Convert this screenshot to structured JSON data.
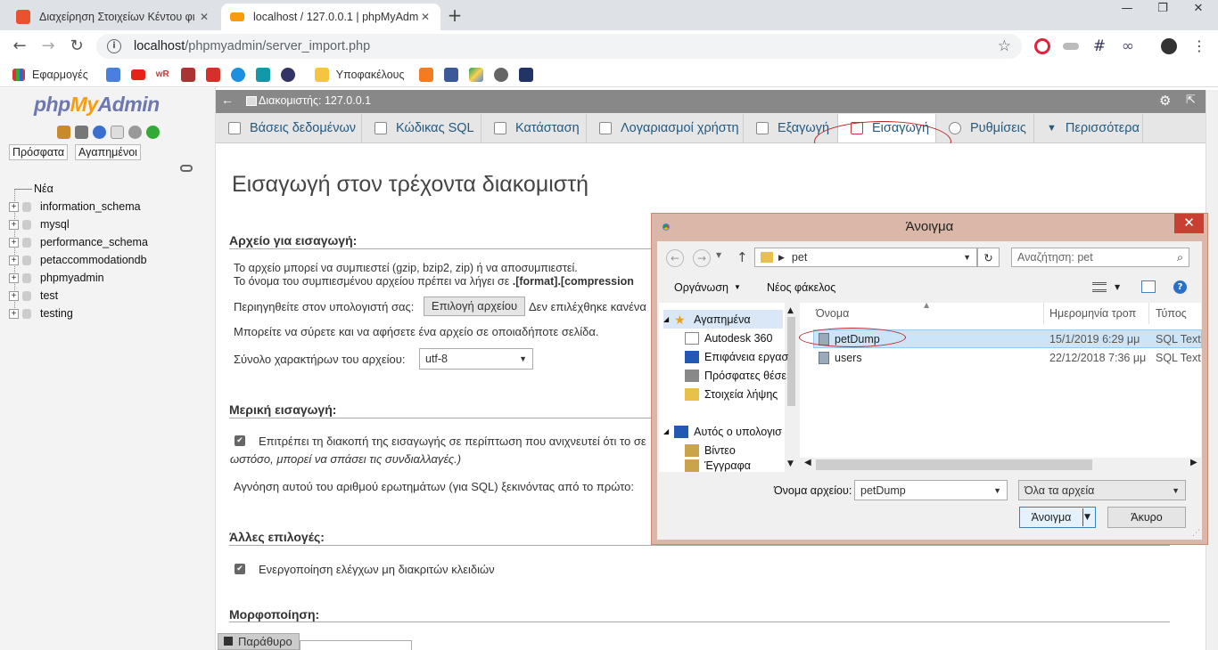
{
  "browser": {
    "tabs": [
      {
        "title": "Διαχείρηση Στοιχείων Κέντου φι"
      },
      {
        "title": "localhost / 127.0.0.1 | phpMyAdm"
      }
    ],
    "url_host": "localhost",
    "url_path": "/phpmyadmin/server_import.php",
    "bookmarks": {
      "apps": "Εφαρμογές",
      "folder": "Υποφακέλους"
    }
  },
  "sidebar": {
    "logo_php": "php",
    "logo_my": "My",
    "logo_admin": "Admin",
    "recent": "Πρόσφατα",
    "favorites": "Αγαπημένοι",
    "new": "Νέα",
    "databases": [
      "information_schema",
      "mysql",
      "performance_schema",
      "petaccommodationdb",
      "phpmyadmin",
      "test",
      "testing"
    ]
  },
  "server_bar": {
    "label": "Διακομιστής: 127.0.0.1"
  },
  "menu": {
    "databases": "Βάσεις δεδομένων",
    "sql": "Κώδικας SQL",
    "status": "Κατάσταση",
    "accounts": "Λογαριασμοί χρήστη",
    "export": "Εξαγωγή",
    "import": "Εισαγωγή",
    "settings": "Ρυθμίσεις",
    "more": "Περισσότερα"
  },
  "page": {
    "title": "Εισαγωγή στον τρέχοντα διακομιστή",
    "file_section": "Αρχείο για εισαγωγή:",
    "compress_note": "Το αρχείο μπορεί να συμπιεστεί (gzip, bzip2, zip) ή να αποσυμπιεστεί.",
    "compress_name_pre": "Το όνομα του συμπιεσμένου αρχείου πρέπει να λήγει σε ",
    "compress_name_bold": ".[format].[compression",
    "browse_label": "Περιηγηθείτε στον υπολογιστή σας:",
    "choose_file": "Επιλογή αρχείου",
    "no_file": "Δεν επιλέχθηκε κανένα",
    "drag_note": "Μπορείτε να σύρετε και να αφήσετε ένα αρχείο σε οποιαδήποτε σελίδα.",
    "charset_label": "Σύνολο χαρακτήρων του αρχείου:",
    "charset_value": "utf-8",
    "partial_section": "Μερική εισαγωγή:",
    "partial_allow": "Επιτρέπει τη διακοπή της εισαγωγής σε περίπτωση που ανιχνευτεί ότι το σε",
    "partial_note": "ωστόσο, μπορεί να σπάσει τις συνδιαλλαγές.)",
    "skip_label": "Αγνόηση αυτού του αριθμού ερωτημάτων (για SQL) ξεκινόντας από το πρώτο:",
    "other_section": "Άλλες επιλογές:",
    "fk_checks": "Ενεργοποίηση ελέγχων μη διακριτών κλειδιών",
    "format_section": "Μορφοποίηση:",
    "console": "Παράθυρο"
  },
  "dialog": {
    "title": "Άνοιγμα",
    "path": "pet",
    "search_placeholder": "Αναζήτηση: pet",
    "organize": "Οργάνωση",
    "new_folder": "Νέος φάκελος",
    "nav": [
      "Αγαπημένα",
      "Autodesk 360",
      "Επιφάνεια εργασ",
      "Πρόσφατες θέσε",
      "Στοιχεία λήψης",
      "Αυτός ο υπολογισ",
      "Βίντεο",
      "Έγγραφα"
    ],
    "columns": {
      "name": "Όνομα",
      "date": "Ημερομηνία τροπ",
      "type": "Τύπος"
    },
    "files": [
      {
        "name": "petDump",
        "date": "15/1/2019 6:29 μμ",
        "type": "SQL Text F"
      },
      {
        "name": "users",
        "date": "22/12/2018 7:36 μμ",
        "type": "SQL Text F"
      }
    ],
    "filename_label": "Όνομα αρχείου:",
    "filename_value": "petDump",
    "filter_value": "Όλα τα αρχεία",
    "open_button": "Άνοιγμα",
    "cancel_button": "Άκυρο"
  }
}
